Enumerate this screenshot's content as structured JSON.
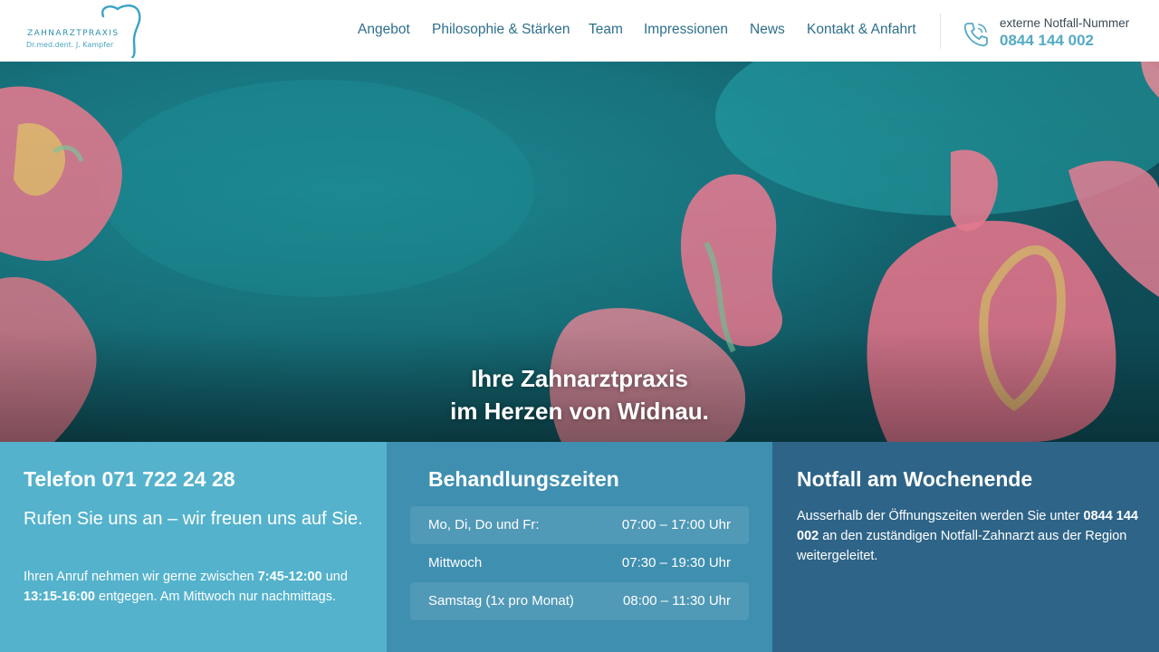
{
  "header": {
    "logo": {
      "name": "ZAHNARZTPRAXIS",
      "subtitle": "Dr.med.dent. J. Kampfer"
    },
    "nav": [
      {
        "label": "Angebot"
      },
      {
        "label": "Philosophie & Stärken"
      },
      {
        "label": "Team"
      },
      {
        "label": "Impressionen"
      },
      {
        "label": "News"
      },
      {
        "label": "Kontakt & Anfahrt"
      }
    ],
    "emergency": {
      "label": "externe Notfall-Nummer",
      "number": "0844 144 002",
      "icon": "phone-icon"
    }
  },
  "hero": {
    "line1": "Ihre Zahnarztpraxis",
    "line2": "im Herzen von Widnau."
  },
  "panels": {
    "phone": {
      "title": "Telefon 071 722 24 28",
      "tagline": "Rufen Sie uns an – wir freuen uns auf Sie.",
      "text_1": "Ihren Anruf nehmen wir gerne zwischen ",
      "time_1": "7:45-12:00",
      "text_2": " und ",
      "time_2": "13:15-16:00",
      "text_3": " entgegen. Am Mittwoch nur nachmittags."
    },
    "hours": {
      "title": "Behandlungszeiten",
      "rows": [
        {
          "day": "Mo, Di, Do und Fr:",
          "time": "07:00 – 17:00 Uhr"
        },
        {
          "day": "Mittwoch",
          "time": "07:30 – 19:30 Uhr"
        },
        {
          "day": "Samstag (1x pro Monat)",
          "time": "08:00 – 11:30 Uhr"
        }
      ]
    },
    "weekend": {
      "title": "Notfall am Wochenende",
      "text_1": "Ausserhalb der Öffnungszeiten werden Sie unter ",
      "number": "0844 144 002",
      "text_2": " an den zuständigen Notfall-Zahnarzt aus der Region weitergeleitet."
    }
  },
  "colors": {
    "accent": "#55aac5",
    "nav_text": "#2d6f8c",
    "panel_1": "#54b2cc",
    "panel_2": "#3f8fb0",
    "panel_3": "#2e6487"
  }
}
